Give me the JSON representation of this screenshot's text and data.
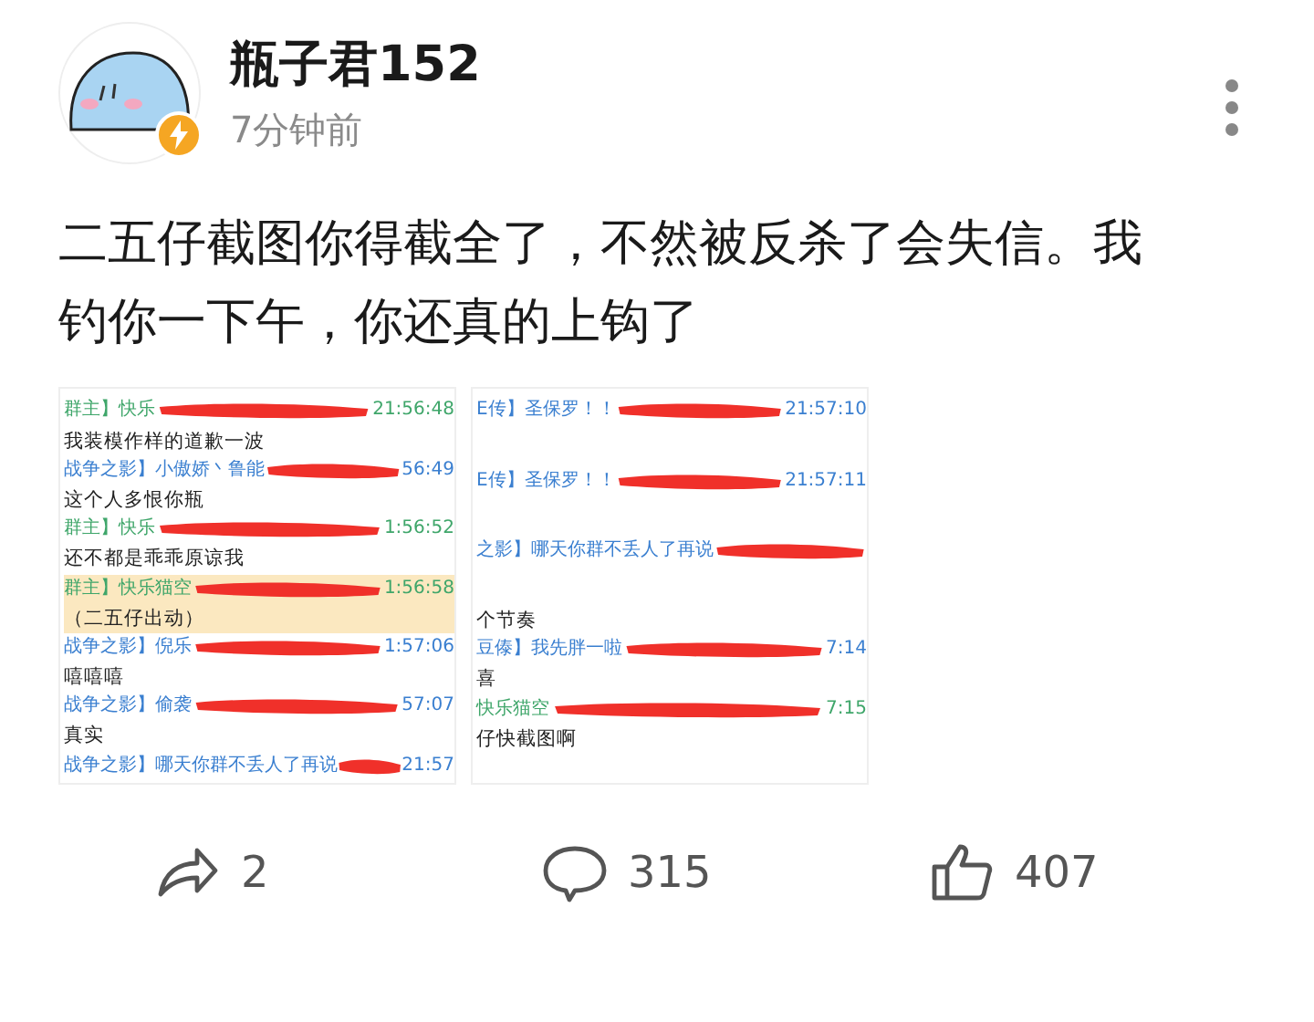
{
  "author": {
    "name": "瓶子君152",
    "time": "7分钟前",
    "verified": true
  },
  "post": {
    "text": "二五仔截图你得截全了，不然被反杀了会失信。我钓你一下午，你还真的上钩了"
  },
  "screenshots": [
    {
      "lines": [
        {
          "kind": "header",
          "name": "群主】快乐",
          "time": "21:56:48",
          "color": "#3fa66a",
          "highlighted": false
        },
        {
          "kind": "message",
          "text": "我装模作样的道歉一波",
          "highlighted": false
        },
        {
          "kind": "header",
          "name": "战争之影】小傲娇丶鲁能",
          "time": "56:49",
          "color": "#3a7fd0",
          "highlighted": false
        },
        {
          "kind": "message",
          "text": "这个人多恨你瓶",
          "highlighted": false
        },
        {
          "kind": "header",
          "name": "群主】快乐",
          "time": "1:56:52",
          "color": "#3fa66a",
          "highlighted": false
        },
        {
          "kind": "message",
          "text": "还不都是乖乖原谅我",
          "highlighted": false
        },
        {
          "kind": "header",
          "name": "群主】快乐猫空",
          "time": "1:56:58",
          "color": "#3fa66a",
          "highlighted": true
        },
        {
          "kind": "message",
          "text": "（二五仔出动）",
          "highlighted": true
        },
        {
          "kind": "header",
          "name": "战争之影】倪乐",
          "time": "1:57:06",
          "color": "#3a7fd0",
          "highlighted": false
        },
        {
          "kind": "message",
          "text": "嘻嘻嘻",
          "highlighted": false
        },
        {
          "kind": "header",
          "name": "战争之影】偷袭",
          "time": "57:07",
          "color": "#3a7fd0",
          "highlighted": false
        },
        {
          "kind": "message",
          "text": "真实",
          "highlighted": false
        },
        {
          "kind": "header",
          "name": "战争之影】哪天你群不丢人了再说",
          "time": "21:57",
          "color": "#3a7fd0",
          "highlighted": false
        }
      ]
    },
    {
      "lines": [
        {
          "kind": "header",
          "name": "E传】圣保罗！！",
          "time": "21:57:10",
          "color": "#3a7fd0",
          "highlighted": false
        },
        {
          "kind": "gap",
          "highlighted": false
        },
        {
          "kind": "header",
          "name": "E传】圣保罗！！",
          "time": "21:57:11",
          "color": "#3a7fd0",
          "highlighted": false
        },
        {
          "kind": "gap",
          "highlighted": false
        },
        {
          "kind": "header",
          "name": "之影】哪天你群不丢人了再说",
          "color": "#3a7fd0",
          "highlighted": false
        },
        {
          "kind": "gap",
          "highlighted": false
        },
        {
          "kind": "message",
          "text": "个节奏",
          "highlighted": false
        },
        {
          "kind": "header",
          "name": "豆傣】我先胖一啦",
          "time": "7:14",
          "color": "#3a7fd0",
          "highlighted": false
        },
        {
          "kind": "message",
          "text": "喜",
          "highlighted": false
        },
        {
          "kind": "header",
          "name": "快乐猫空",
          "time": "7:15",
          "color": "#3fa66a",
          "highlighted": false
        },
        {
          "kind": "message",
          "text": "仔快截图啊",
          "highlighted": false
        }
      ]
    }
  ],
  "actions": [
    {
      "kind": "share",
      "count": "2"
    },
    {
      "kind": "comment",
      "count": "315"
    },
    {
      "kind": "like",
      "count": "407"
    }
  ]
}
